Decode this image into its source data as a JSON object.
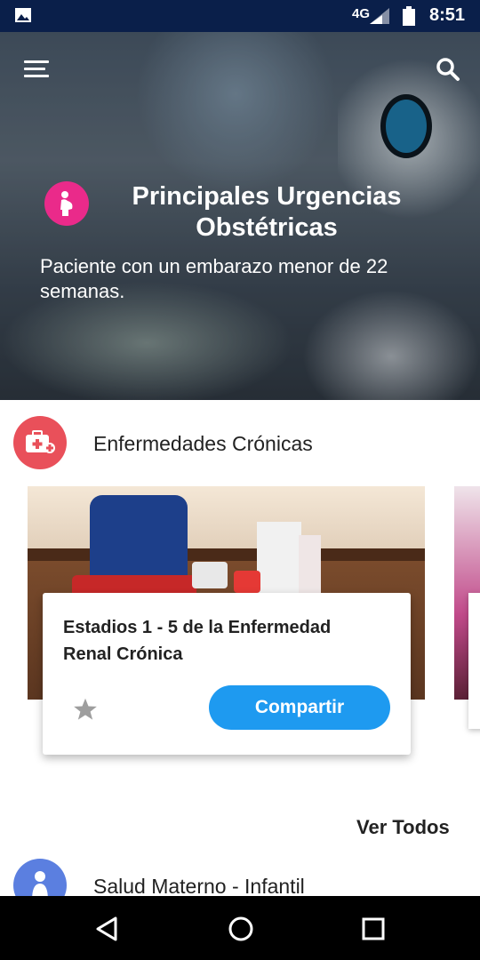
{
  "status_bar": {
    "network": "4G",
    "time": "8:51",
    "icons": [
      "image-icon",
      "signal-icon",
      "battery-icon"
    ]
  },
  "hero": {
    "title": "Principales Urgencias Obstétricas",
    "subtitle": "Paciente con un embarazo menor de 22 semanas.",
    "badge_color": "#ea2a8a",
    "icons": [
      "menu-icon",
      "search-icon",
      "pregnant-woman-icon"
    ]
  },
  "section_cronicas": {
    "label": "Enfermedades Crónicas",
    "icon": "medical-kit-icon",
    "icon_color": "#e9505a",
    "card": {
      "title": "Estadios 1 - 5 de la Enfermedad Renal Crónica",
      "share_label": "Compartir",
      "share_color": "#1e9af0",
      "favorite_icon": "star-icon"
    },
    "see_all": "Ver Todos"
  },
  "section_materno": {
    "label": "Salud Materno - Infantil",
    "icon": "mother-child-icon",
    "icon_color": "#5b7fe0"
  },
  "nav_bar": {
    "buttons": [
      "back-icon",
      "home-icon",
      "recent-apps-icon"
    ]
  }
}
